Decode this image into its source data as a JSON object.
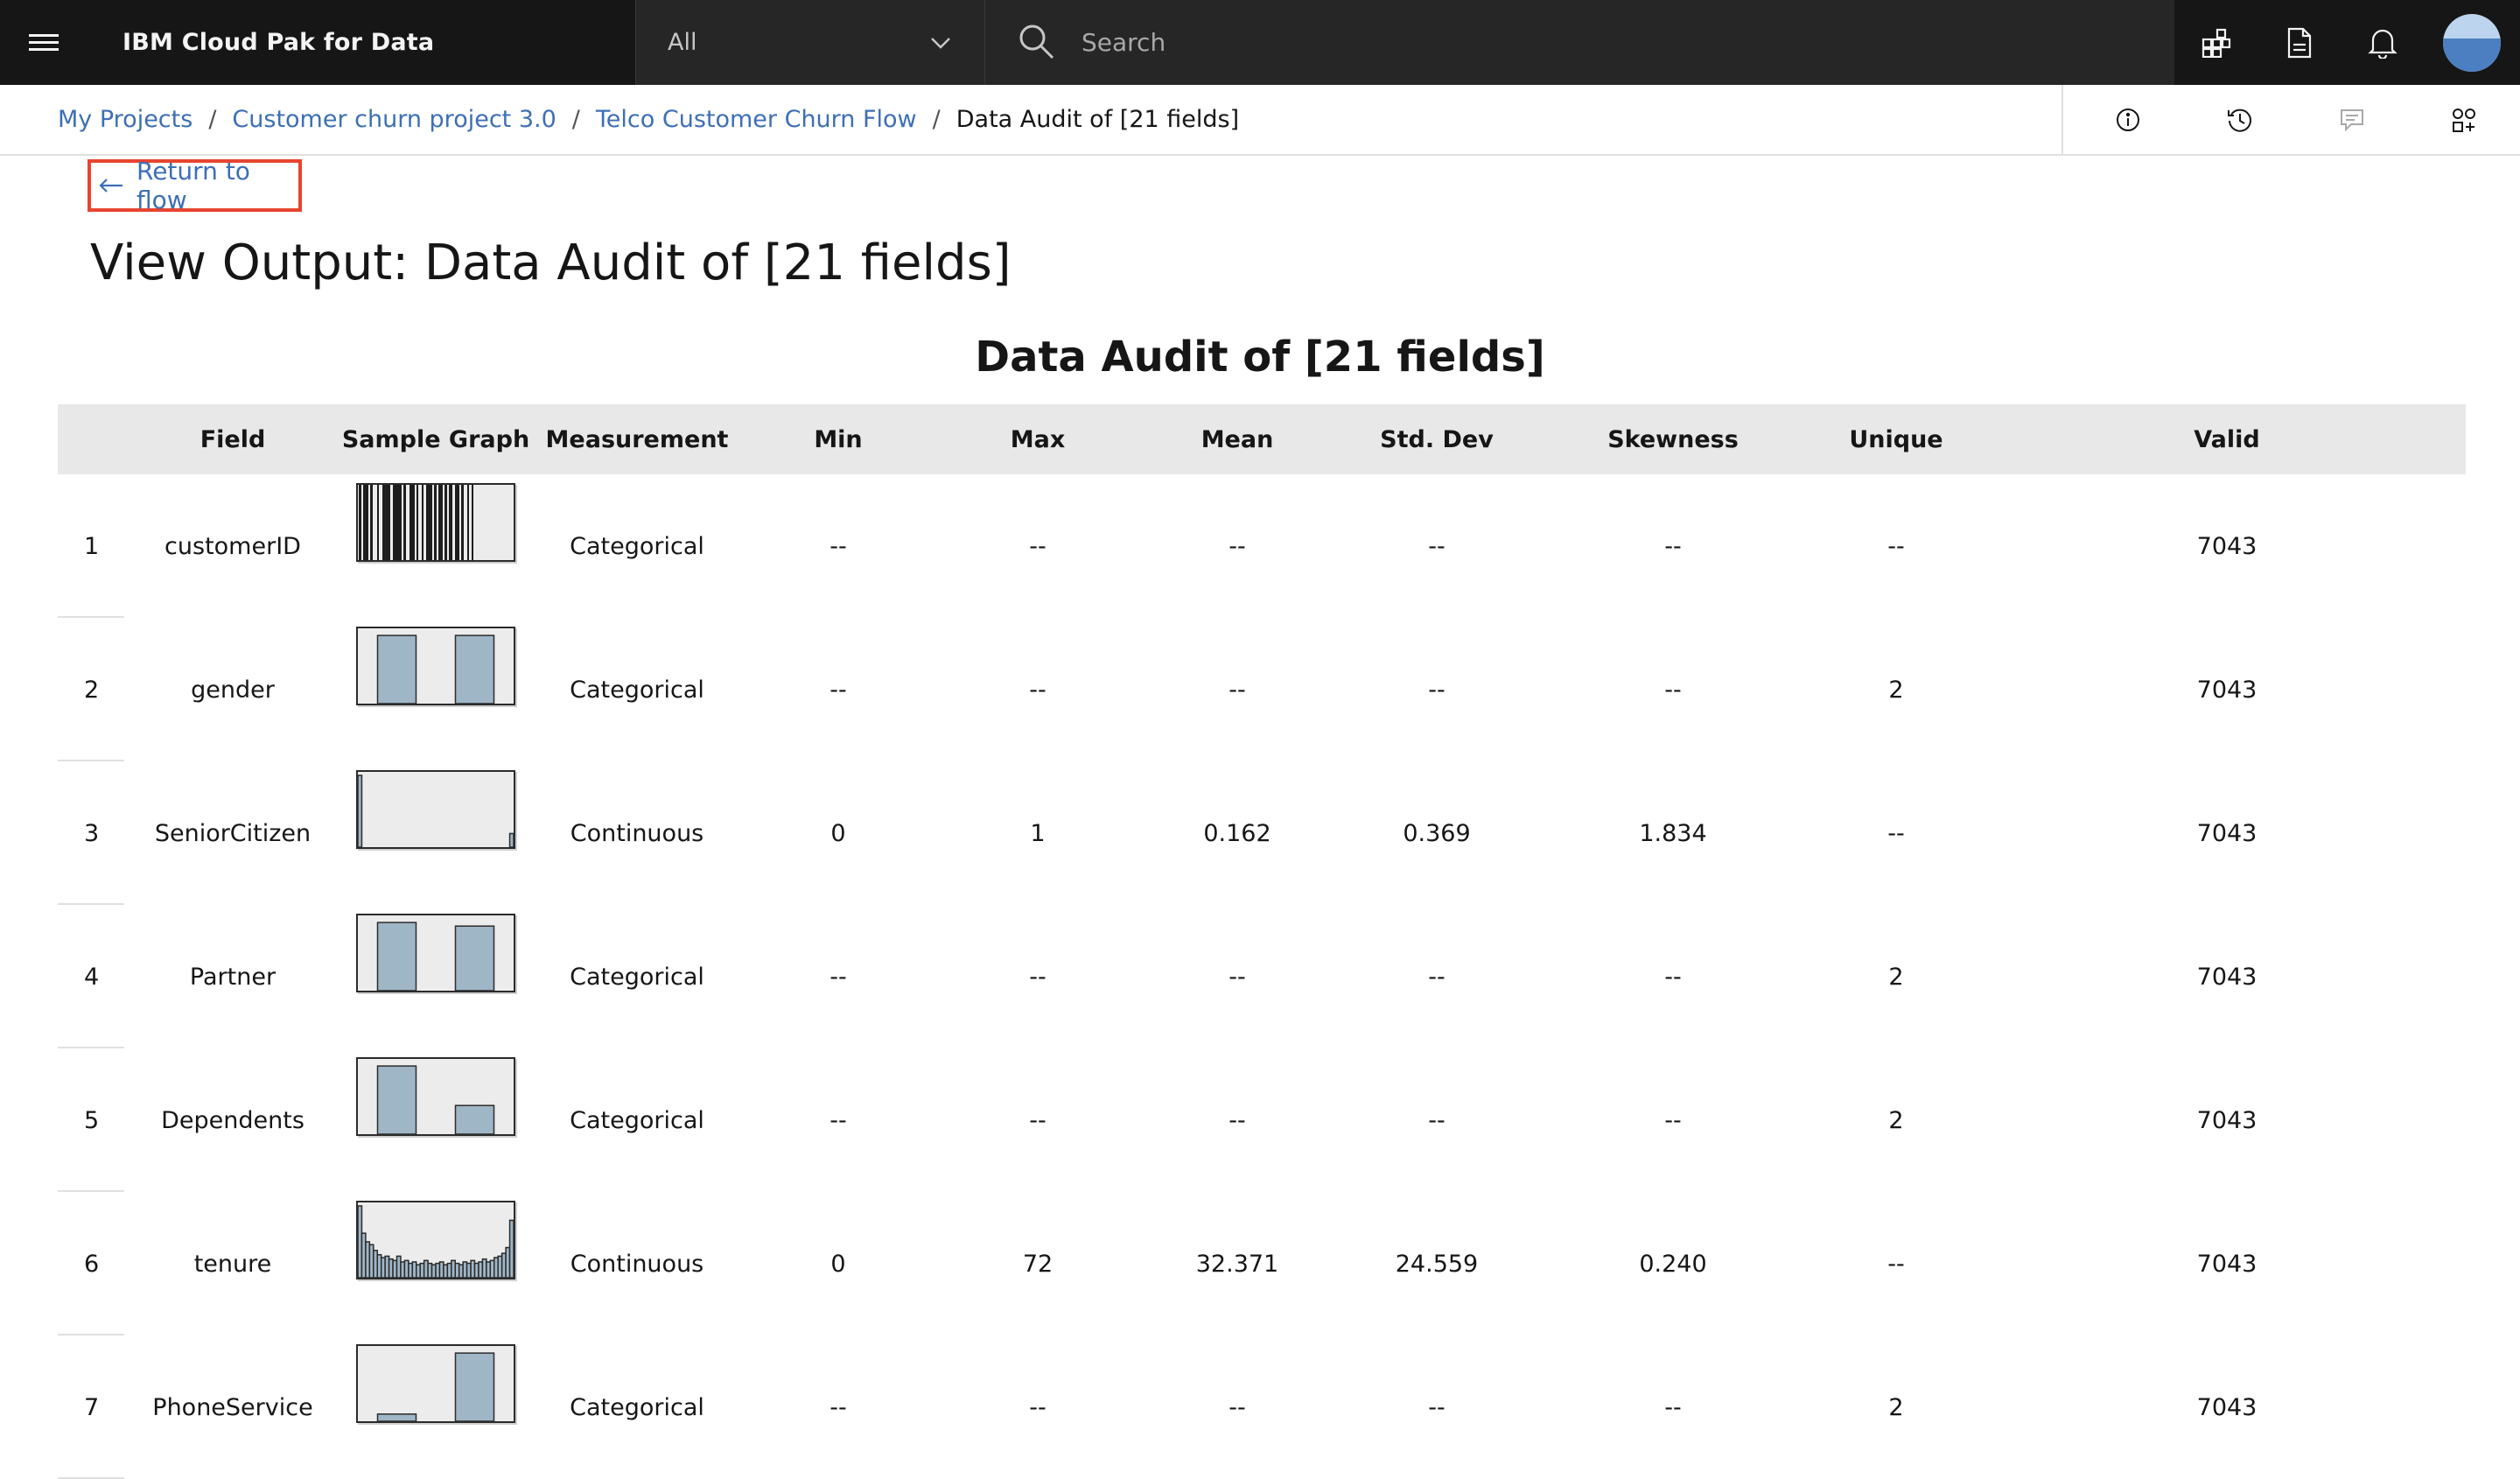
{
  "header": {
    "product_name": "IBM Cloud Pak for Data",
    "scope_select_value": "All",
    "search_placeholder": "Search"
  },
  "icons": {
    "menu": "hamburger-menu-icon",
    "scope_dropdown": "chevron-down-icon",
    "search": "search-icon",
    "header_actions": [
      "grid-apps-icon",
      "document-icon",
      "notification-bell-icon"
    ],
    "avatar": "user-avatar",
    "crumb_actions": [
      "information-icon",
      "history-icon",
      "comment-icon",
      "settings-adjust-icon"
    ],
    "return": "arrow-left-icon"
  },
  "breadcrumb": {
    "items": [
      "My Projects",
      "Customer churn project 3.0",
      "Telco Customer Churn Flow"
    ],
    "current": "Data Audit of [21 fields]",
    "separator": "/"
  },
  "page": {
    "return_label": "Return to flow",
    "title": "View Output: Data Audit of [21 fields]"
  },
  "colors": {
    "nav_background": "#161616",
    "link": "#3d6fb5",
    "highlight_border": "#e8442f",
    "bar_fill": "#9fb6c7",
    "header_row": "#e8e8e8"
  },
  "table": {
    "title": "Data Audit of [21 fields]",
    "columns": [
      "",
      "Field",
      "Sample Graph",
      "Measurement",
      "Min",
      "Max",
      "Mean",
      "Std. Dev",
      "Skewness",
      "Unique",
      "Valid"
    ],
    "rows": [
      {
        "index": "1",
        "field": "customerID",
        "graph": {
          "kind": "barcode"
        },
        "measurement": "Categorical",
        "min": "--",
        "max": "--",
        "mean": "--",
        "std_dev": "--",
        "skewness": "--",
        "unique": "--",
        "valid": "7043"
      },
      {
        "index": "2",
        "field": "gender",
        "graph": {
          "kind": "bars",
          "values": [
            0.95,
            0.95
          ]
        },
        "measurement": "Categorical",
        "min": "--",
        "max": "--",
        "mean": "--",
        "std_dev": "--",
        "skewness": "--",
        "unique": "2",
        "valid": "7043"
      },
      {
        "index": "3",
        "field": "SeniorCitizen",
        "graph": {
          "kind": "histogram",
          "values": [
            1.0,
            0.0,
            0.0,
            0.0,
            0.0,
            0.0,
            0.0,
            0.0,
            0.0,
            0.0,
            0.0,
            0.0,
            0.0,
            0.0,
            0.0,
            0.0,
            0.0,
            0.0,
            0.0,
            0.0,
            0.0,
            0.0,
            0.0,
            0.0,
            0.0,
            0.0,
            0.0,
            0.0,
            0.0,
            0.0,
            0.0,
            0.0,
            0.0,
            0.0,
            0.0,
            0.0,
            0.0,
            0.0,
            0.0,
            0.19
          ]
        },
        "measurement": "Continuous",
        "min": "0",
        "max": "1",
        "mean": "0.162",
        "std_dev": "0.369",
        "skewness": "1.834",
        "unique": "--",
        "valid": "7043"
      },
      {
        "index": "4",
        "field": "Partner",
        "graph": {
          "kind": "bars",
          "values": [
            0.95,
            0.9
          ]
        },
        "measurement": "Categorical",
        "min": "--",
        "max": "--",
        "mean": "--",
        "std_dev": "--",
        "skewness": "--",
        "unique": "2",
        "valid": "7043"
      },
      {
        "index": "5",
        "field": "Dependents",
        "graph": {
          "kind": "bars",
          "values": [
            0.95,
            0.4
          ]
        },
        "measurement": "Categorical",
        "min": "--",
        "max": "--",
        "mean": "--",
        "std_dev": "--",
        "skewness": "--",
        "unique": "2",
        "valid": "7043"
      },
      {
        "index": "6",
        "field": "tenure",
        "graph": {
          "kind": "histogram",
          "values": [
            1.0,
            0.62,
            0.5,
            0.46,
            0.38,
            0.32,
            0.28,
            0.3,
            0.26,
            0.24,
            0.3,
            0.22,
            0.24,
            0.2,
            0.22,
            0.18,
            0.2,
            0.24,
            0.2,
            0.18,
            0.2,
            0.22,
            0.18,
            0.2,
            0.24,
            0.2,
            0.18,
            0.22,
            0.2,
            0.24,
            0.2,
            0.22,
            0.26,
            0.22,
            0.24,
            0.28,
            0.3,
            0.34,
            0.42,
            0.8
          ]
        },
        "measurement": "Continuous",
        "min": "0",
        "max": "72",
        "mean": "32.371",
        "std_dev": "24.559",
        "skewness": "0.240",
        "unique": "--",
        "valid": "7043"
      },
      {
        "index": "7",
        "field": "PhoneService",
        "graph": {
          "kind": "bars",
          "values": [
            0.1,
            0.95
          ]
        },
        "measurement": "Categorical",
        "min": "--",
        "max": "--",
        "mean": "--",
        "std_dev": "--",
        "skewness": "--",
        "unique": "2",
        "valid": "7043"
      }
    ]
  }
}
